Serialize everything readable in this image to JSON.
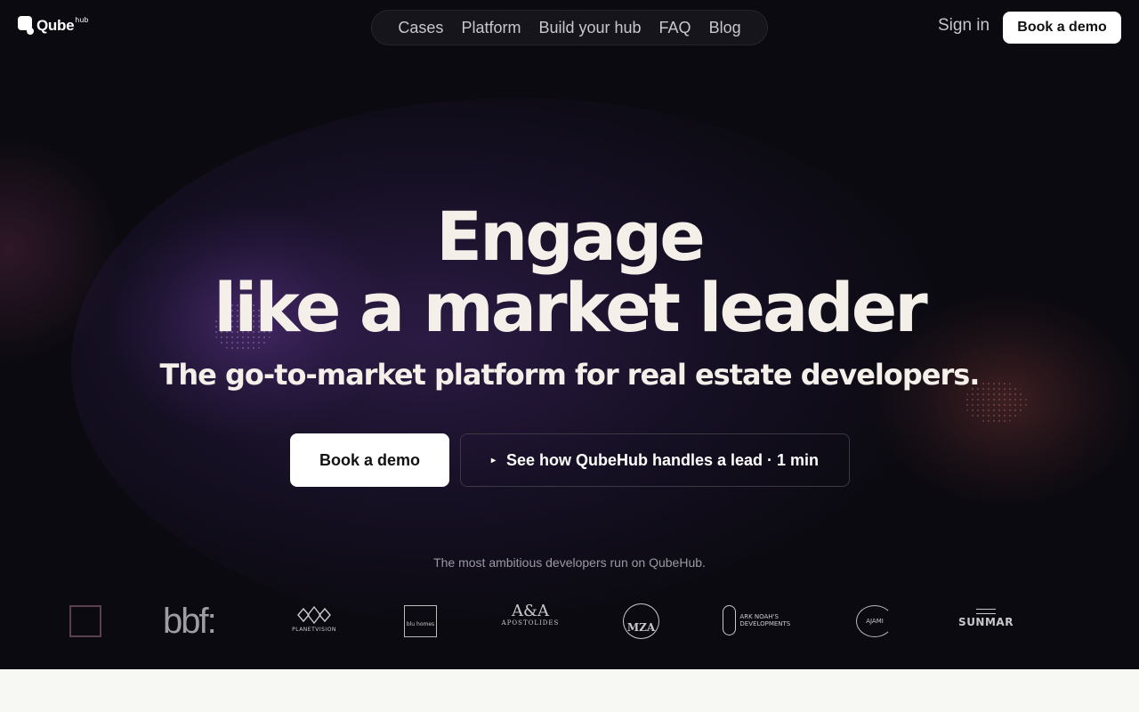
{
  "header": {
    "logo_text": "Qube",
    "logo_sup": "hub",
    "nav": [
      "Cases",
      "Platform",
      "Build your hub",
      "FAQ",
      "Blog"
    ],
    "sign_in": "Sign in",
    "demo_button": "Book a demo"
  },
  "hero": {
    "headline_line1": "Engage",
    "headline_line2": "like a market leader",
    "subheadline": "The go-to-market platform for real estate developers.",
    "primary_button": "Book a demo",
    "play_icon": "▸",
    "secondary_button": "See how QubeHub handles a lead · 1 min"
  },
  "trusted": {
    "caption": "The most ambitious developers run on QubeHub.",
    "logos": {
      "bbf": "bbf:",
      "planetvision": "PLANETVISION",
      "blu_homes": "blu homes",
      "aa_big": "A&A",
      "aa_small": "APOSTOLIDES",
      "mza": "MZA",
      "ark": "ARK NOAH'S DEVELOPMENTS",
      "ajami": "AJAMI",
      "sunmar": "SUNMAR"
    }
  },
  "colors": {
    "hero_bg": "#0b0a10",
    "page_bg": "#f7f8f3",
    "headline": "#f4efe9",
    "button_bg": "#ffffff"
  }
}
